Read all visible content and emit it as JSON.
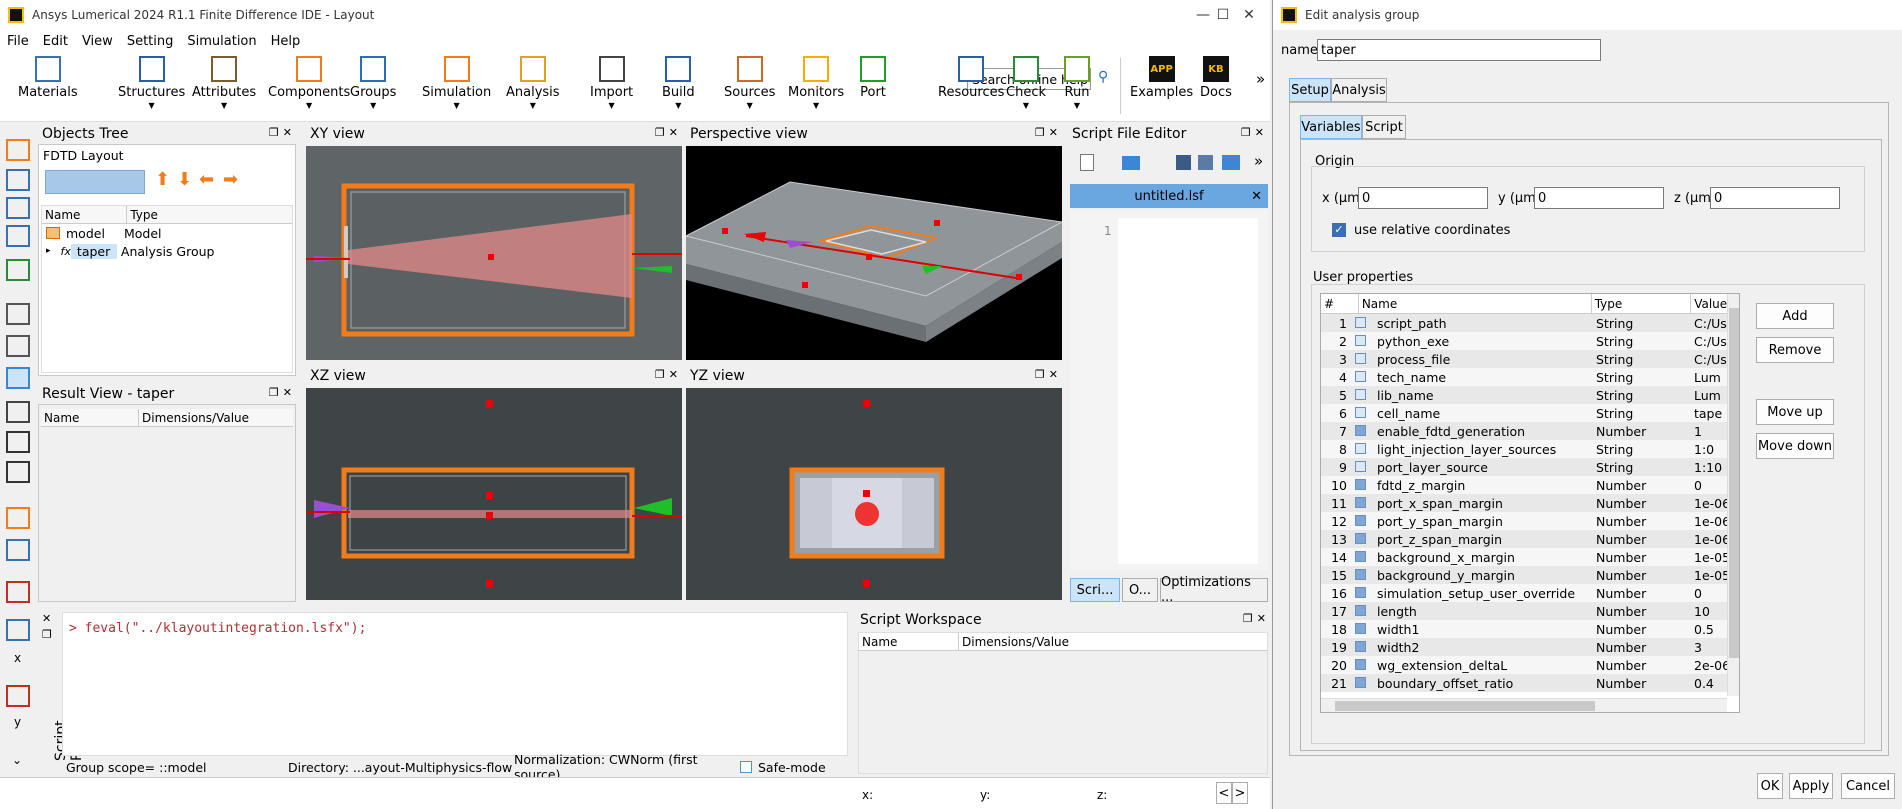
{
  "main_window": {
    "title": "Ansys Lumerical 2024 R1.1 Finite Difference IDE - Layout",
    "menu": [
      "File",
      "Edit",
      "View",
      "Setting",
      "Simulation",
      "Help"
    ],
    "toolbar": [
      "Materials",
      "Structures",
      "Attributes",
      "Components",
      "Groups",
      "Simulation",
      "Analysis",
      "Import",
      "Build",
      "Sources",
      "Monitors",
      "Port",
      "Resources",
      "Check",
      "Run"
    ],
    "search_placeholder": "Search online help",
    "extra": [
      "Examples",
      "Docs"
    ],
    "extra_icons": [
      "APP",
      "KB"
    ],
    "more": "»"
  },
  "objects_tree": {
    "title": "Objects Tree",
    "root": "FDTD Layout",
    "headers": [
      "Name",
      "Type"
    ],
    "rows": [
      {
        "name": "model",
        "type": "Model"
      },
      {
        "name": "taper",
        "type": "Analysis Group"
      }
    ]
  },
  "result_view": {
    "title": "Result View - taper",
    "headers": [
      "Name",
      "Dimensions/Value"
    ]
  },
  "views": {
    "xy": "XY view",
    "perspective": "Perspective view",
    "xz": "XZ view",
    "yz": "YZ view"
  },
  "script_editor": {
    "title": "Script File Editor",
    "tab": "untitled.lsf",
    "line": "1",
    "bottom_tabs": [
      "Scri...",
      "O...",
      "Optimizations ..."
    ]
  },
  "script_prompt": {
    "title": "Script Prompt",
    "command": "> feval(\"../klayoutintegration.lsfx\");",
    "status_scope": "Group scope= ::model",
    "status_dir": "Directory: ...ayout-Multiphysics-flow",
    "status_norm": "Normalization: CWNorm (first source)",
    "safe_mode": "Safe-mode"
  },
  "script_workspace": {
    "title": "Script Workspace",
    "headers": [
      "Name",
      "Dimensions/Value"
    ]
  },
  "coords": {
    "x": "x:",
    "y": "y:",
    "z": "z:"
  },
  "left_axis": {
    "x": "x",
    "y": "y"
  },
  "dialog": {
    "title": "Edit analysis group",
    "name_label": "name",
    "name_value": "taper",
    "tabs": [
      "Setup",
      "Analysis"
    ],
    "subtabs": [
      "Variables",
      "Script"
    ],
    "origin": {
      "label": "Origin",
      "x_label": "x (μm)",
      "x": "0",
      "y_label": "y (μm)",
      "y": "0",
      "z_label": "z (μm)",
      "z": "0"
    },
    "relative": "use relative coordinates",
    "user_props_label": "User properties",
    "headers": [
      "#",
      "Name",
      "Type",
      "Value"
    ],
    "props": [
      {
        "n": "1",
        "name": "script_path",
        "type": "String",
        "value": "C:/Us"
      },
      {
        "n": "2",
        "name": "python_exe",
        "type": "String",
        "value": "C:/Us"
      },
      {
        "n": "3",
        "name": "process_file",
        "type": "String",
        "value": "C:/Us"
      },
      {
        "n": "4",
        "name": "tech_name",
        "type": "String",
        "value": "Lum"
      },
      {
        "n": "5",
        "name": "lib_name",
        "type": "String",
        "value": "Lum"
      },
      {
        "n": "6",
        "name": "cell_name",
        "type": "String",
        "value": "tape"
      },
      {
        "n": "7",
        "name": "enable_fdtd_generation",
        "type": "Number",
        "value": "1"
      },
      {
        "n": "8",
        "name": "light_injection_layer_sources",
        "type": "String",
        "value": "1:0"
      },
      {
        "n": "9",
        "name": "port_layer_source",
        "type": "String",
        "value": "1:10"
      },
      {
        "n": "10",
        "name": "fdtd_z_margin",
        "type": "Number",
        "value": "0"
      },
      {
        "n": "11",
        "name": "port_x_span_margin",
        "type": "Number",
        "value": "1e-06"
      },
      {
        "n": "12",
        "name": "port_y_span_margin",
        "type": "Number",
        "value": "1e-06"
      },
      {
        "n": "13",
        "name": "port_z_span_margin",
        "type": "Number",
        "value": "1e-06"
      },
      {
        "n": "14",
        "name": "background_x_margin",
        "type": "Number",
        "value": "1e-05"
      },
      {
        "n": "15",
        "name": "background_y_margin",
        "type": "Number",
        "value": "1e-05"
      },
      {
        "n": "16",
        "name": "simulation_setup_user_override",
        "type": "Number",
        "value": "0"
      },
      {
        "n": "17",
        "name": "length",
        "type": "Number",
        "value": "10"
      },
      {
        "n": "18",
        "name": "width1",
        "type": "Number",
        "value": "0.5"
      },
      {
        "n": "19",
        "name": "width2",
        "type": "Number",
        "value": "3"
      },
      {
        "n": "20",
        "name": "wg_extension_deltaL",
        "type": "Number",
        "value": "2e-06"
      },
      {
        "n": "21",
        "name": "boundary_offset_ratio",
        "type": "Number",
        "value": "0.4"
      }
    ],
    "side_buttons": [
      "Add",
      "Remove",
      "Move up",
      "Move down"
    ],
    "footer_buttons": [
      "OK",
      "Apply",
      "Cancel"
    ]
  }
}
